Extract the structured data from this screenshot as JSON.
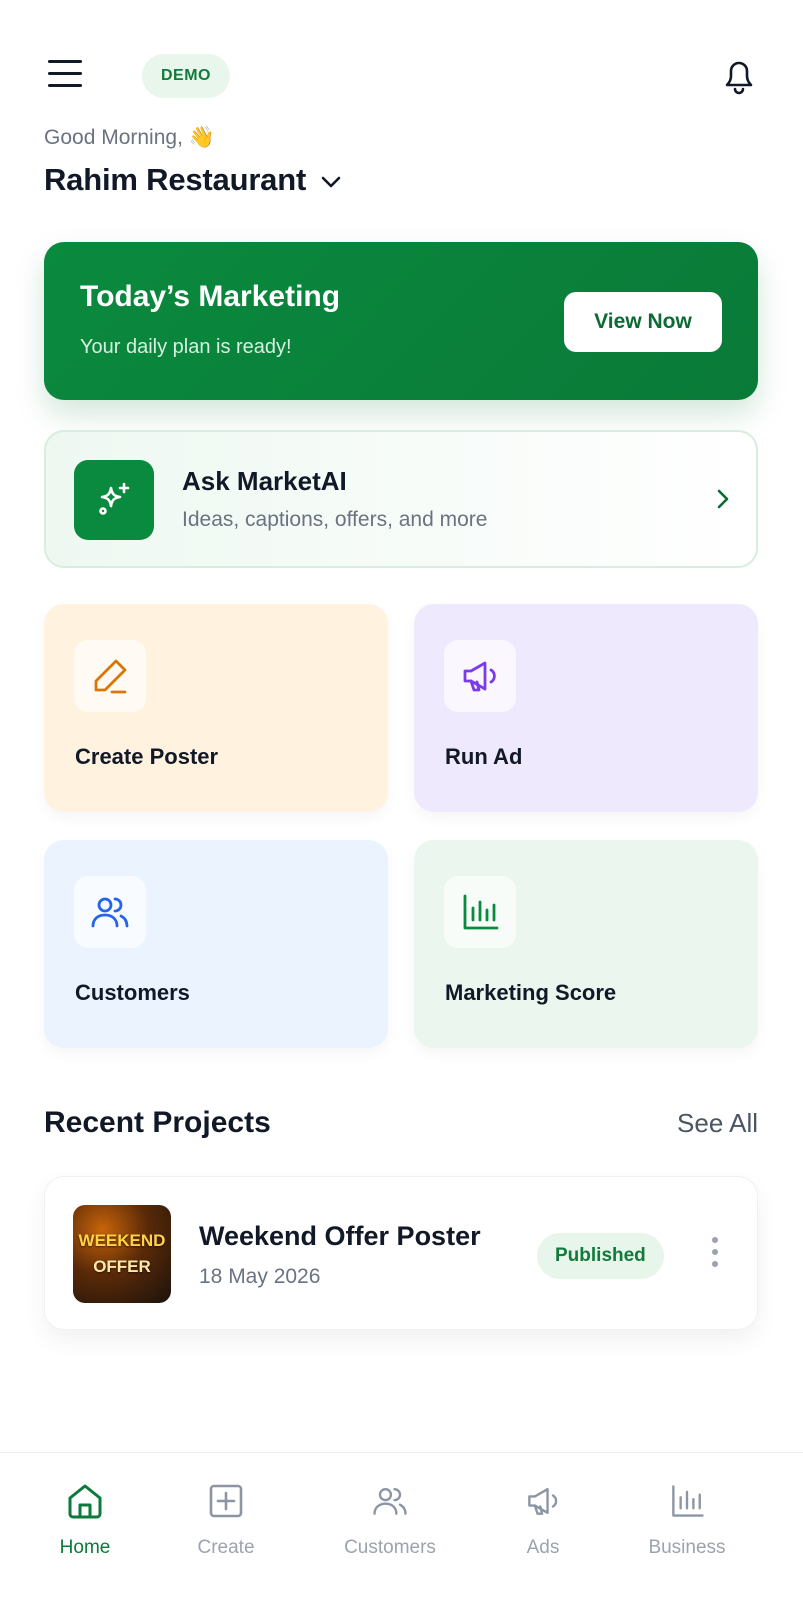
{
  "header": {
    "badge": "DEMO"
  },
  "greeting": "Good Morning, 👋",
  "business": {
    "name": "Rahim Restaurant"
  },
  "hero": {
    "title": "Today’s Marketing",
    "subtitle": "Your daily plan is ready!",
    "cta": "View Now"
  },
  "assistant": {
    "title": "Ask MarketAI",
    "subtitle": "Ideas, captions, offers, and more"
  },
  "actions": [
    {
      "label": "Create Poster",
      "icon": "pencil-icon",
      "color": "#d97706"
    },
    {
      "label": "Run Ad",
      "icon": "megaphone-icon",
      "color": "#7c3aed"
    },
    {
      "label": "Customers",
      "icon": "users-icon",
      "color": "#2563eb"
    },
    {
      "label": "Marketing Score",
      "icon": "bar-chart-icon",
      "color": "#0a8a3e"
    }
  ],
  "recent": {
    "title": "Recent Projects",
    "see_all": "See All",
    "items": [
      {
        "thumb_line1": "WEEKEND",
        "thumb_line2": "OFFER",
        "title": "Weekend Offer Poster",
        "date": "18 May 2026",
        "status": "Published"
      }
    ]
  },
  "nav": [
    {
      "label": "Home",
      "icon": "home-icon",
      "active": true
    },
    {
      "label": "Create",
      "icon": "plus-square-icon",
      "active": false
    },
    {
      "label": "Customers",
      "icon": "users-icon",
      "active": false
    },
    {
      "label": "Ads",
      "icon": "megaphone-icon",
      "active": false
    },
    {
      "label": "Business",
      "icon": "bar-chart-icon",
      "active": false
    }
  ],
  "colors": {
    "brand": "#0a8a3e",
    "brand_dark": "#0b6b33",
    "muted": "#6b7280"
  }
}
